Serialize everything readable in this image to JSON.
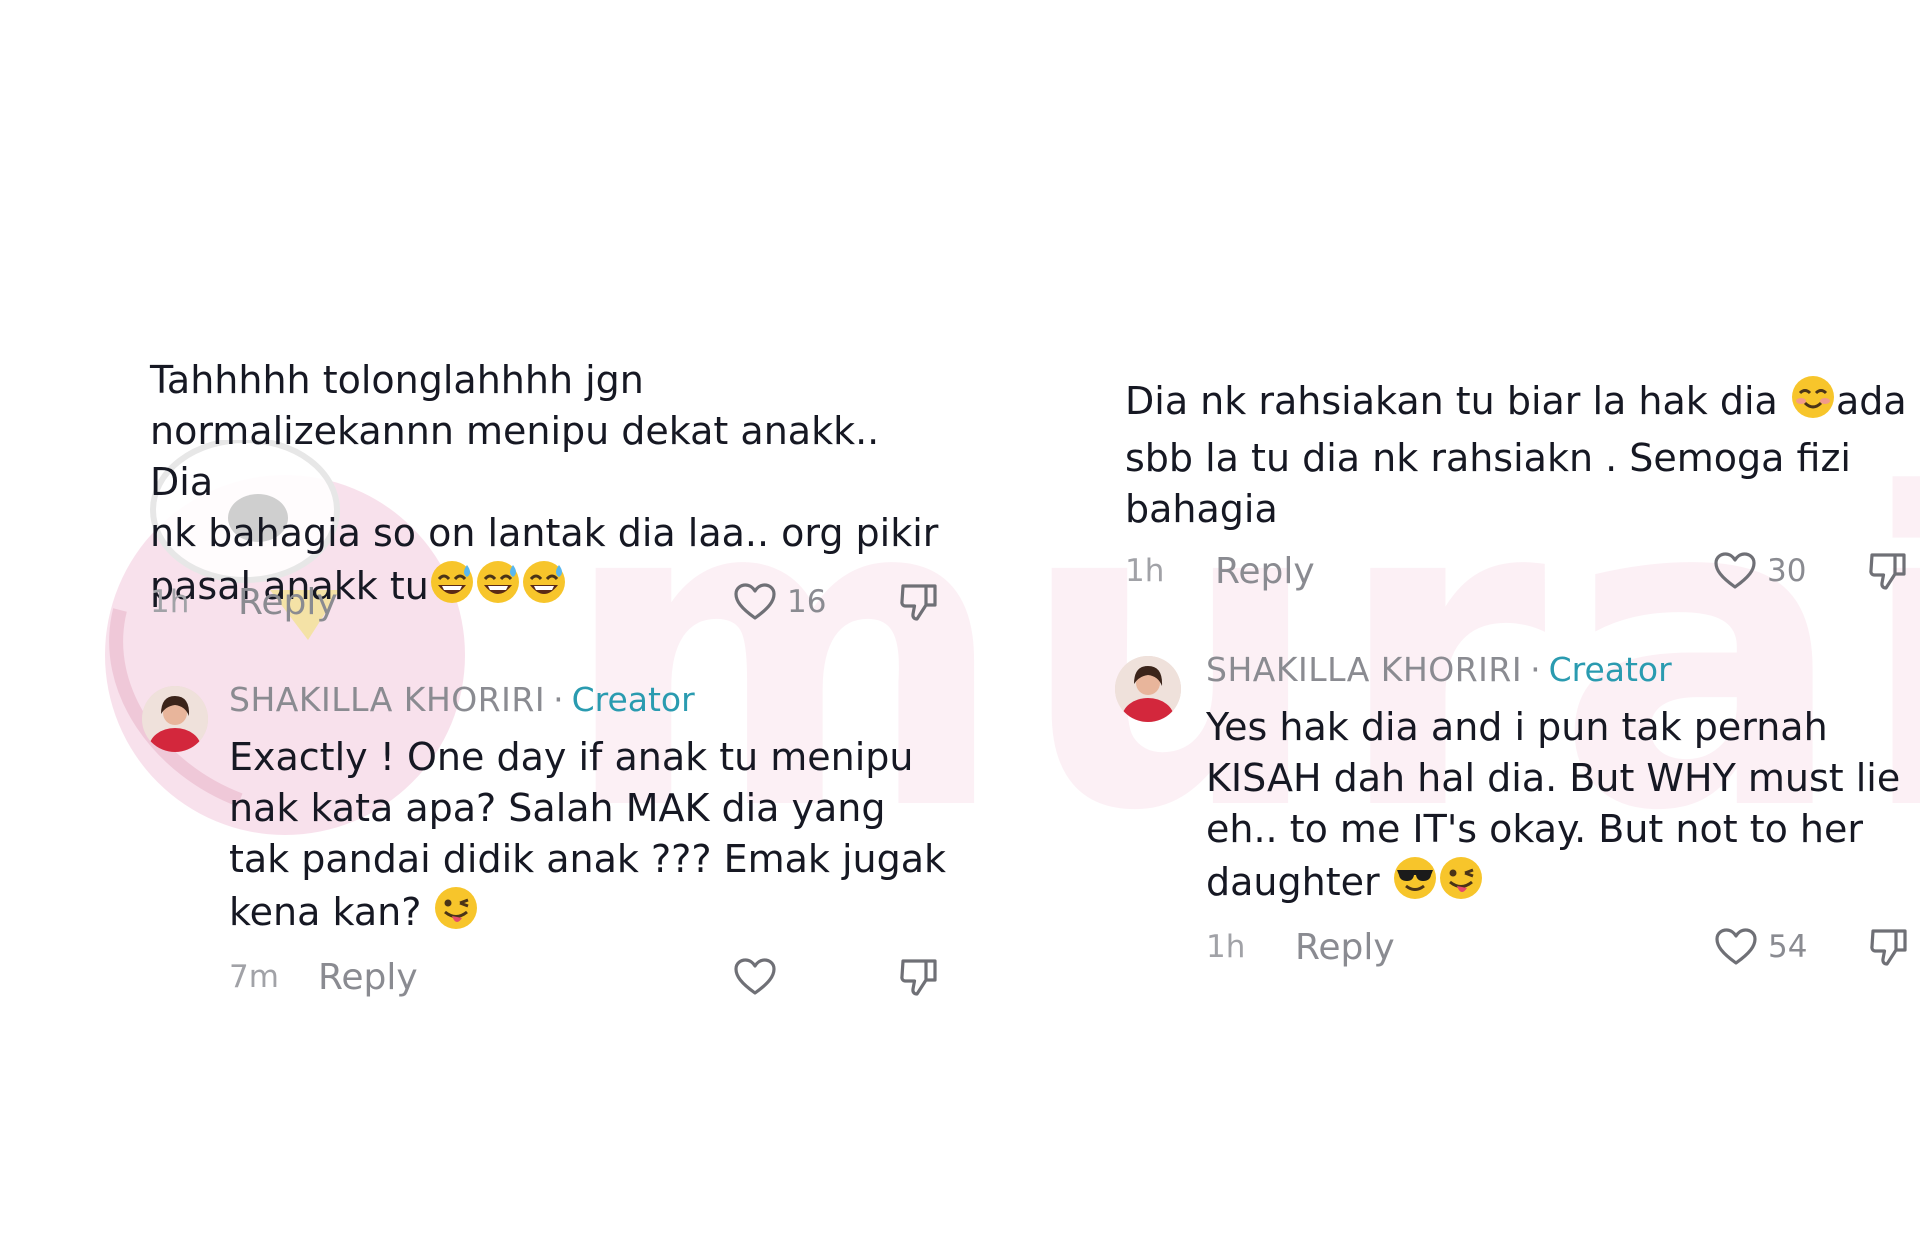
{
  "left_thread": {
    "comment": {
      "text": "Tahhhhh tolonglahhhh jgn normalizekannn menipu dekat anakk.. Dia nk bahagia so on lantak dia laa.. org pikir pasal anakk tu",
      "line1": "Tahhhhh tolonglahhhh jgn",
      "line2": "normalizekannn menipu dekat anakk.. Dia",
      "line3": "nk bahagia so on lantak dia laa.. org pikir",
      "line4": "pasal anakk tu",
      "emojis": [
        "sweat-smile",
        "sweat-smile",
        "sweat-smile"
      ],
      "time": "1h",
      "reply_label": "Reply",
      "likes": "16"
    },
    "reply": {
      "username": "SHAKILLA KHORIRI",
      "separator": "·",
      "badge": "Creator",
      "line1": "Exactly ! One day if anak tu menipu",
      "line2": "nak kata apa? Salah MAK dia yang",
      "line3": "tak pandai didik anak ??? Emak jugak",
      "line4": "kena kan?",
      "emojis": [
        "winking-tongue"
      ],
      "time": "7m",
      "reply_label": "Reply",
      "likes": ""
    }
  },
  "right_thread": {
    "comment": {
      "line1a": "Dia nk rahsiakan tu biar la hak dia ",
      "line1b": "ada",
      "line2": "sbb la tu dia nk rahsiakn . Semoga fizi",
      "line3": "bahagia",
      "emojis": [
        "smiling-blush"
      ],
      "time": "1h",
      "reply_label": "Reply",
      "likes": "30"
    },
    "reply": {
      "username": "SHAKILLA KHORIRI",
      "separator": "·",
      "badge": "Creator",
      "line1": "Yes hak dia and i pun tak pernah",
      "line2": "KISAH dah hal dia. But WHY must lie",
      "line3": "eh.. to me IT's okay. But not to her",
      "line4": "daughter ",
      "emojis": [
        "sunglasses",
        "winking-tongue"
      ],
      "time": "1h",
      "reply_label": "Reply",
      "likes": "54"
    }
  },
  "watermark": {
    "text": "murai",
    "color": "#ecaac8"
  },
  "colors": {
    "text": "#161823",
    "muted": "#8a8b91",
    "creator": "#2a9bb0"
  },
  "icons": [
    "heart-outline-icon",
    "thumbs-down-icon",
    "avatar-image"
  ]
}
